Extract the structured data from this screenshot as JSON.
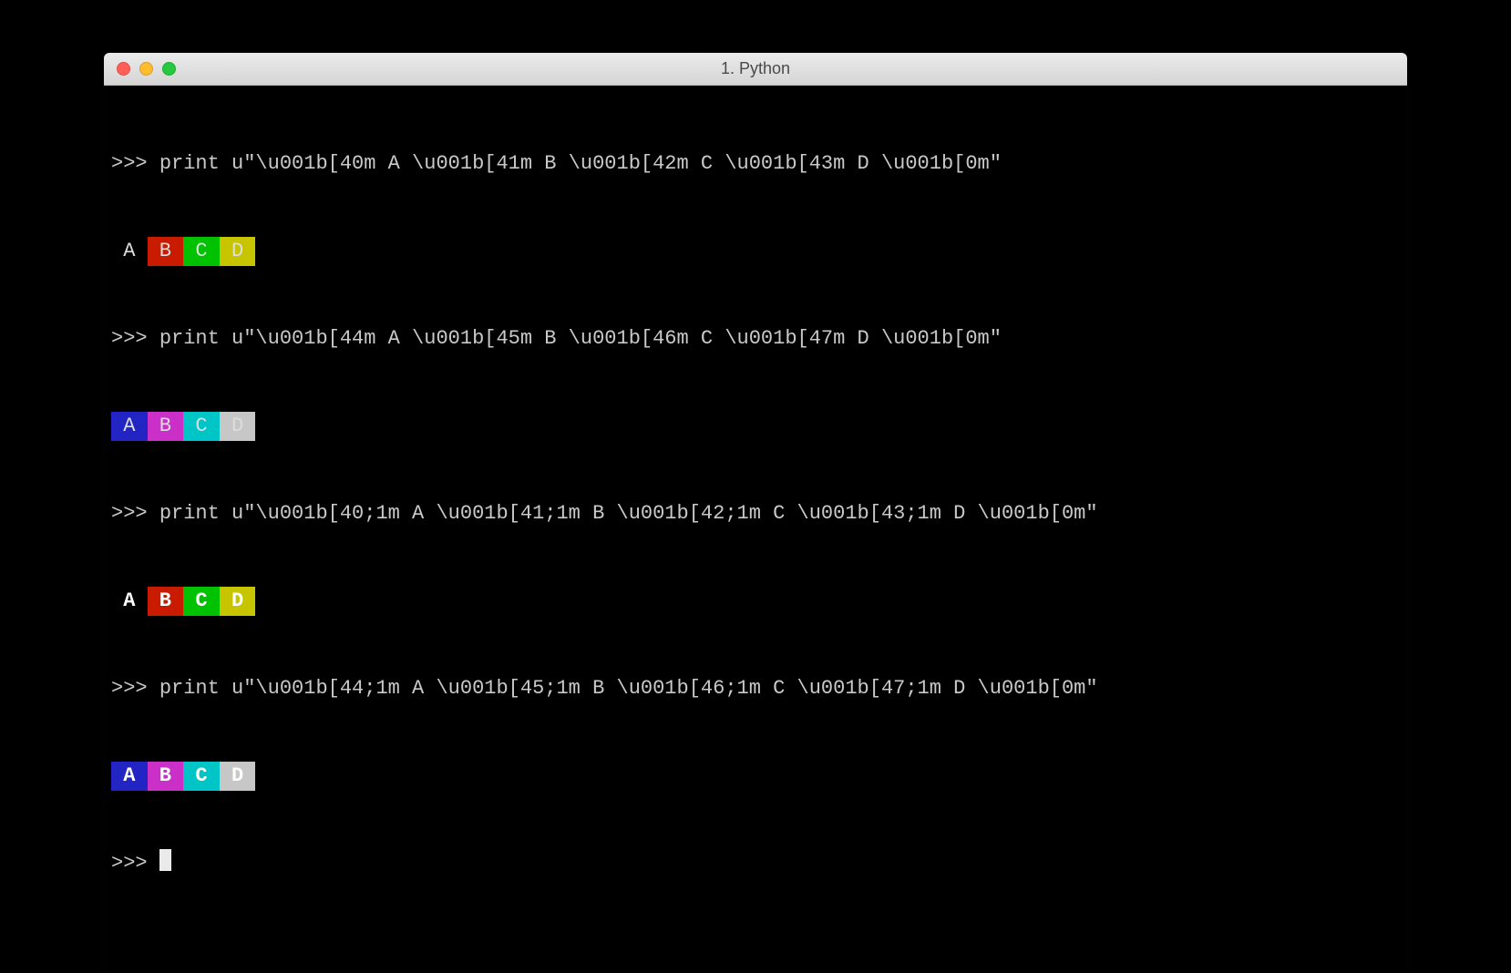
{
  "window": {
    "title": "1. Python"
  },
  "colors": {
    "ansi40": "#000000",
    "ansi41": "#c91b00",
    "ansi42": "#00c200",
    "ansi43": "#c7c400",
    "ansi44": "#2225c4",
    "ansi45": "#ca30c7",
    "ansi46": "#00c5c7",
    "ansi47": "#c7c7c7"
  },
  "prompt": ">>> ",
  "lines": [
    {
      "cmd": "print u\"\\u001b[40m A \\u001b[41m B \\u001b[42m C \\u001b[43m D \\u001b[0m\"",
      "out": [
        {
          "bg": "ansi40",
          "t": " A ",
          "bold": false
        },
        {
          "bg": "ansi41",
          "t": " B ",
          "bold": false
        },
        {
          "bg": "ansi42",
          "t": " C ",
          "bold": false
        },
        {
          "bg": "ansi43",
          "t": " D ",
          "bold": false
        }
      ]
    },
    {
      "cmd": "print u\"\\u001b[44m A \\u001b[45m B \\u001b[46m C \\u001b[47m D \\u001b[0m\"",
      "out": [
        {
          "bg": "ansi44",
          "t": " A ",
          "bold": false
        },
        {
          "bg": "ansi45",
          "t": " B ",
          "bold": false
        },
        {
          "bg": "ansi46",
          "t": " C ",
          "bold": false
        },
        {
          "bg": "ansi47",
          "t": " D ",
          "bold": false
        }
      ]
    },
    {
      "cmd": "print u\"\\u001b[40;1m A \\u001b[41;1m B \\u001b[42;1m C \\u001b[43;1m D \\u001b[0m\"",
      "out": [
        {
          "bg": "ansi40",
          "t": " A ",
          "bold": true
        },
        {
          "bg": "ansi41",
          "t": " B ",
          "bold": true
        },
        {
          "bg": "ansi42",
          "t": " C ",
          "bold": true
        },
        {
          "bg": "ansi43",
          "t": " D ",
          "bold": true
        }
      ]
    },
    {
      "cmd": "print u\"\\u001b[44;1m A \\u001b[45;1m B \\u001b[46;1m C \\u001b[47;1m D \\u001b[0m\"",
      "out": [
        {
          "bg": "ansi44",
          "t": " A ",
          "bold": true
        },
        {
          "bg": "ansi45",
          "t": " B ",
          "bold": true
        },
        {
          "bg": "ansi46",
          "t": " C ",
          "bold": true
        },
        {
          "bg": "ansi47",
          "t": " D ",
          "bold": true
        }
      ]
    }
  ]
}
